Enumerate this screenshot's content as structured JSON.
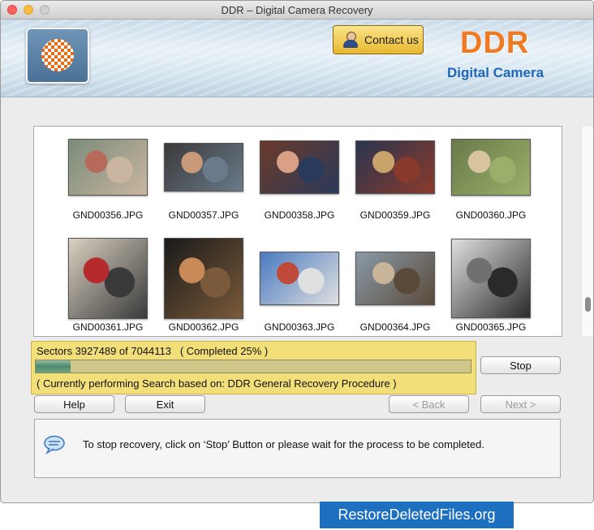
{
  "window": {
    "title": "DDR – Digital Camera Recovery"
  },
  "header": {
    "contact_label": "Contact us",
    "brand": "DDR",
    "brand_sub": "Digital Camera",
    "brand_color": "#f07a21",
    "sub_color": "#1f66b8"
  },
  "gallery": {
    "items": [
      {
        "name": "GND00356.JPG",
        "colors": [
          "#7a8c7a",
          "#b86a5a",
          "#c9b5a0"
        ]
      },
      {
        "name": "GND00357.JPG",
        "colors": [
          "#3a3a3a",
          "#c99a7a",
          "#6a7a8a"
        ]
      },
      {
        "name": "GND00358.JPG",
        "colors": [
          "#6b3a2a",
          "#d9a085",
          "#2a3a5a"
        ]
      },
      {
        "name": "GND00359.JPG",
        "colors": [
          "#2a3550",
          "#c9a46a",
          "#8a3a2a"
        ]
      },
      {
        "name": "GND00360.JPG",
        "colors": [
          "#6a7a4a",
          "#d9c4a0",
          "#9ab06a"
        ]
      },
      {
        "name": "GND00361.JPG",
        "colors": [
          "#d9d0c0",
          "#b52a2a",
          "#3a3a3a"
        ]
      },
      {
        "name": "GND00362.JPG",
        "colors": [
          "#1a1a1a",
          "#c98a5a",
          "#7a5a3a"
        ]
      },
      {
        "name": "GND00363.JPG",
        "colors": [
          "#4a7ac0",
          "#c04a3a",
          "#e0e0e0"
        ]
      },
      {
        "name": "GND00364.JPG",
        "colors": [
          "#8a9aa8",
          "#c9b59a",
          "#5a4a3a"
        ]
      },
      {
        "name": "GND00365.JPG",
        "colors": [
          "#e0e0e0",
          "#707070",
          "#2a2a2a"
        ]
      }
    ]
  },
  "status": {
    "sectors_line": "Sectors 3927489 of 7044113   ( Completed 25% )",
    "procedure_line": "( Currently performing Search based on: DDR General Recovery Procedure )",
    "progress": 0.08
  },
  "buttons": {
    "stop": "Stop",
    "help": "Help",
    "exit": "Exit",
    "back": "< Back",
    "next": "Next >"
  },
  "info": {
    "message": "To stop recovery, click on ‘Stop’ Button or please wait for the process to be completed."
  },
  "footer": {
    "badge": "RestoreDeletedFiles.org"
  }
}
